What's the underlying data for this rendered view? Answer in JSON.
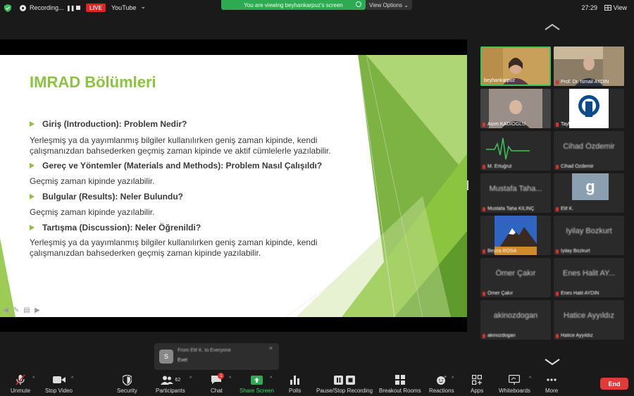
{
  "topbar": {
    "recording_label": "Recording...",
    "pause_glyph": "❚❚",
    "live_badge": "LIVE",
    "stream_label": "YouTube",
    "stream_caret": "⌄",
    "share_banner": "You are viewing beyhankarpuz's screen",
    "view_options": "View Options ⌄",
    "timer": "27:29",
    "view_button": "View",
    "live_color": "#e02424",
    "banner_color": "#2eaa52"
  },
  "slide": {
    "title": "IMRAD Bölümleri",
    "sections": [
      {
        "heading": "Giriş (Introduction): Problem Nedir?",
        "body": "Yerleşmiş ya da yayımlanmış bilgiler kullanılırken geniş zaman kipinde, kendi çalışmanızdan bahsederken geçmiş zaman kipinde ve aktif cümlelerle yazılabilir."
      },
      {
        "heading": "Gereç ve Yöntemler (Materials and Methods): Problem Nasıl Çalışıldı?",
        "body": "Geçmiş zaman kipinde yazılabilir."
      },
      {
        "heading": "Bulgular (Results): Neler Bulundu?",
        "body": "Geçmiş zaman kipinde yazılabilir."
      },
      {
        "heading": "Tartışma (Discussion): Neler Öğrenildi?",
        "body": "Yerleşmiş ya da yayımlanmış bilgiler kullanılırken geniş zaman kipinde, kendi çalışmanızdan bahsederken geçmiş zaman kipinde yazılabilir."
      }
    ],
    "accent_color": "#8bc43f",
    "nav_icons": [
      "arrow-left-icon",
      "pen-icon",
      "menu-icon",
      "arrow-right-icon"
    ]
  },
  "participants": [
    {
      "name": "beyhankarpuz",
      "kind": "video",
      "active": true
    },
    {
      "name": "Prof. Dr. Ismail AYDIN",
      "kind": "video"
    },
    {
      "name": "Asım KADIOGLU",
      "kind": "video"
    },
    {
      "name": "Tayfun DEDE",
      "kind": "logo"
    },
    {
      "name": "M. Ertuğrul",
      "kind": "audio-wave"
    },
    {
      "name": "Cihad Özdemir",
      "kind": "name",
      "display": "Cihad Özdemir"
    },
    {
      "name": "Mustafa Taha KILINÇ",
      "kind": "name",
      "display": "Mustafa Taha..."
    },
    {
      "name": "Elif K.",
      "kind": "avatar",
      "display": "g"
    },
    {
      "name": "Beyza ROSA",
      "kind": "image"
    },
    {
      "name": "Iyilay Bozkurt",
      "kind": "name",
      "display": "Iyilay Bozkurt"
    },
    {
      "name": "Ömer Çakır",
      "kind": "name",
      "display": "Ömer Çakır"
    },
    {
      "name": "Enes Halit AYDIN",
      "kind": "name",
      "display": "Enes Halit AY..."
    },
    {
      "name": "akinozdogan",
      "kind": "name",
      "display": "akinozdogan"
    },
    {
      "name": "Hatice Ayyıldız",
      "kind": "name",
      "display": "Hatice Ayyıldız"
    }
  ],
  "chat_popup": {
    "avatar_letter": "S",
    "from": "From Elif K. to Everyone",
    "message": "Evet",
    "close": "✕"
  },
  "toolbar": {
    "unmute": "Unmute",
    "stop_video": "Stop Video",
    "security": "Security",
    "participants": "Participants",
    "participant_count": "62",
    "chat": "Chat",
    "chat_badge": "1",
    "share_screen": "Share Screen",
    "polls": "Polls",
    "pause_recording": "Pause/Stop Recording",
    "breakout": "Breakout Rooms",
    "reactions": "Reactions",
    "apps": "Apps",
    "whiteboards": "Whiteboards",
    "more": "More",
    "end": "End",
    "caret": "^",
    "share_color": "#2eaa52",
    "end_color": "#e03a3a"
  }
}
